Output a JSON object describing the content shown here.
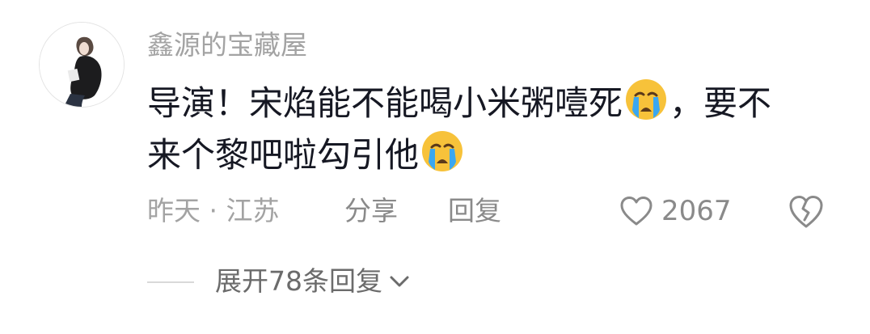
{
  "comment": {
    "username": "鑫源的宝藏屋",
    "text_line1_a": "导演！宋焰能不能喝小米粥噎死",
    "text_line1_b": "，要不",
    "text_line2": "来个黎吧啦勾引他",
    "emoji": "loudly-crying-face",
    "time_location": "昨天 · 江苏",
    "share_label": "分享",
    "reply_label": "回复",
    "like_count": "2067",
    "expand_label": "展开78条回复"
  },
  "icons": {
    "like": "heart-outline-icon",
    "dislike": "broken-heart-icon",
    "expand": "chevron-down-icon"
  },
  "colors": {
    "text_primary": "#161823",
    "text_secondary": "#a3a3a3",
    "action_text": "#8a8a8a",
    "emoji_face": "#f7c23a",
    "emoji_tear": "#3aa7f0"
  }
}
